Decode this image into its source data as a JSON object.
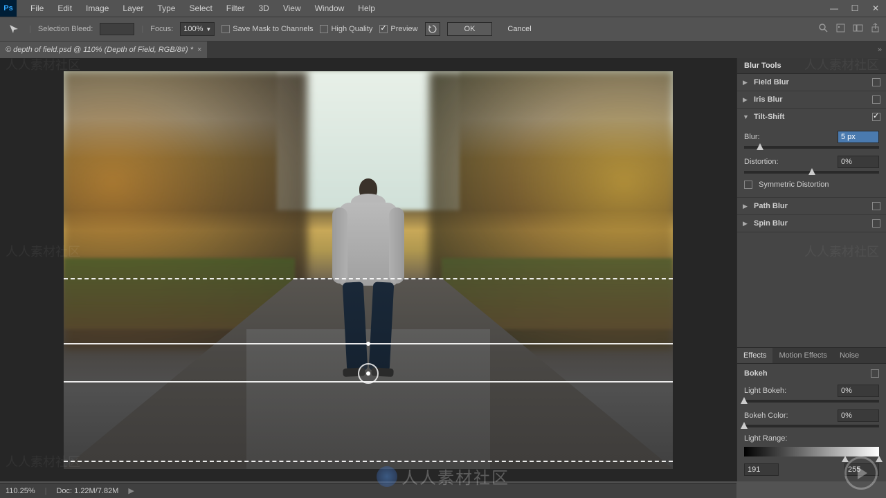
{
  "menubar": [
    "File",
    "Edit",
    "Image",
    "Layer",
    "Type",
    "Select",
    "Filter",
    "3D",
    "View",
    "Window",
    "Help"
  ],
  "optionsbar": {
    "selection_bleed_label": "Selection Bleed:",
    "focus_label": "Focus:",
    "focus_value": "100%",
    "save_mask_label": "Save Mask to Channels",
    "high_quality_label": "High Quality",
    "preview_label": "Preview",
    "ok_label": "OK",
    "cancel_label": "Cancel"
  },
  "document_tab": "© depth of field.psd @ 110% (Depth of Field, RGB/8#) *",
  "blur_tools": {
    "panel_title": "Blur Tools",
    "field_blur": "Field Blur",
    "iris_blur": "Iris Blur",
    "tilt_shift": "Tilt-Shift",
    "tilt_shift_blur_label": "Blur:",
    "tilt_shift_blur_value": "5 px",
    "tilt_shift_distortion_label": "Distortion:",
    "tilt_shift_distortion_value": "0%",
    "symmetric_distortion_label": "Symmetric Distortion",
    "path_blur": "Path Blur",
    "spin_blur": "Spin Blur"
  },
  "effects": {
    "tabs": [
      "Effects",
      "Motion Effects",
      "Noise"
    ],
    "bokeh_label": "Bokeh",
    "light_bokeh_label": "Light Bokeh:",
    "light_bokeh_value": "0%",
    "bokeh_color_label": "Bokeh Color:",
    "bokeh_color_value": "0%",
    "light_range_label": "Light Range:",
    "light_range_low": "191",
    "light_range_high": "255"
  },
  "statusbar": {
    "zoom": "110.25%",
    "doc_info": "Doc: 1.22M/7.82M"
  },
  "watermark_text": "人人素材社区"
}
